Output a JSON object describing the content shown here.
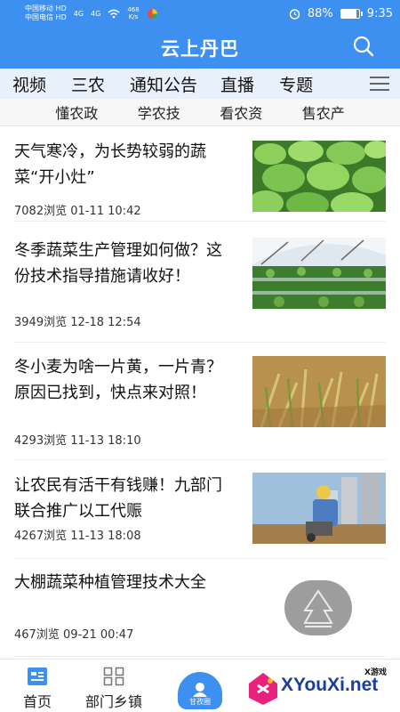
{
  "status_bar": {
    "carrier1": "中国移动",
    "carrier2": "中国电信",
    "hd1": "HD",
    "hd2": "HD",
    "sig1": "4G",
    "sig2": "4G",
    "net_speed": "468",
    "net_unit": "K/s",
    "battery": "88%",
    "battery_level": 0.88,
    "time": "9:35"
  },
  "header": {
    "title": "云上丹巴"
  },
  "tabs": [
    "视频",
    "三农",
    "通知公告",
    "直播",
    "专题"
  ],
  "subtabs": [
    "懂农政",
    "学农技",
    "看农资",
    "售农产"
  ],
  "articles": [
    {
      "title": "天气寒冷，为长势较弱的蔬菜“开小灶”",
      "views": "7082浏览",
      "date": "01-11 10:42",
      "thumb": "lettuce"
    },
    {
      "title": "冬季蔬菜生产管理如何做？这份技术指导措施请收好！",
      "views": "3949浏览",
      "date": "12-18 12:54",
      "thumb": "greenhouse"
    },
    {
      "title": "冬小麦为啥一片黄，一片青？原因已找到，快点来对照！",
      "views": "4293浏览",
      "date": "11-13 18:10",
      "thumb": "wheat"
    },
    {
      "title": "让农民有活干有钱赚！九部门联合推广以工代赈",
      "views": "4267浏览",
      "date": "11-13 18:08",
      "thumb": "worker"
    },
    {
      "title": "大棚蔬菜种植管理技术大全",
      "views": "467浏览",
      "date": "09-21 00:47",
      "thumb": ""
    }
  ],
  "bottom_nav": {
    "home": "首页",
    "dept": "部门乡镇",
    "center_small": "甘孜圈"
  },
  "colors": {
    "accent": "#3d8ff0",
    "tab_bg": "#e8f0fb"
  },
  "icons": [
    "search-icon",
    "menu-icon",
    "home-icon",
    "grid-icon",
    "center-icon"
  ],
  "watermark": {
    "text": "XYouXi.net",
    "small": "X游戏"
  }
}
